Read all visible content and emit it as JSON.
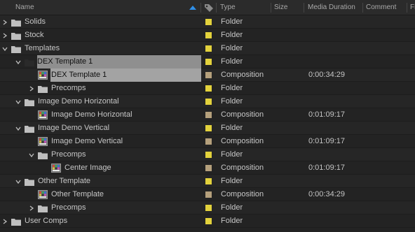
{
  "header": {
    "name": "Name",
    "type": "Type",
    "size": "Size",
    "media_duration": "Media Duration",
    "comment": "Comment",
    "fi": "Fi",
    "sort_direction": "ascending",
    "label_icon": "tag-icon",
    "sort_color": "#2f8fe8"
  },
  "colors": {
    "folder_label": "#e3d23c",
    "composition_label": "#b5a07c",
    "selection": "#a3a3a3"
  },
  "rows": [
    {
      "name": "Solids",
      "type": "Folder",
      "duration": "",
      "kind": "folder",
      "depth": 0,
      "expanded": false,
      "selected": false
    },
    {
      "name": "Stock",
      "type": "Folder",
      "duration": "",
      "kind": "folder",
      "depth": 0,
      "expanded": false,
      "selected": false
    },
    {
      "name": "Templates",
      "type": "Folder",
      "duration": "",
      "kind": "folder",
      "depth": 0,
      "expanded": true,
      "selected": false
    },
    {
      "name": "DEX Template 1",
      "type": "Folder",
      "duration": "",
      "kind": "folder",
      "depth": 1,
      "expanded": true,
      "selected": true
    },
    {
      "name": "DEX Template 1",
      "type": "Composition",
      "duration": "0:00:34:29",
      "kind": "comp",
      "depth": 2,
      "selected": true
    },
    {
      "name": "Precomps",
      "type": "Folder",
      "duration": "",
      "kind": "folder",
      "depth": 2,
      "expanded": false,
      "selected": false
    },
    {
      "name": "Image Demo Horizontal",
      "type": "Folder",
      "duration": "",
      "kind": "folder",
      "depth": 1,
      "expanded": true,
      "selected": false
    },
    {
      "name": "Image Demo Horizontal",
      "type": "Composition",
      "duration": "0:01:09:17",
      "kind": "comp",
      "depth": 2,
      "selected": false
    },
    {
      "name": "Image Demo Vertical",
      "type": "Folder",
      "duration": "",
      "kind": "folder",
      "depth": 1,
      "expanded": true,
      "selected": false
    },
    {
      "name": "Image Demo Vertical",
      "type": "Composition",
      "duration": "0:01:09:17",
      "kind": "comp",
      "depth": 2,
      "selected": false
    },
    {
      "name": "Precomps",
      "type": "Folder",
      "duration": "",
      "kind": "folder",
      "depth": 2,
      "expanded": true,
      "selected": false
    },
    {
      "name": "Center Image",
      "type": "Composition",
      "duration": "0:01:09:17",
      "kind": "comp",
      "depth": 3,
      "selected": false
    },
    {
      "name": "Other Template",
      "type": "Folder",
      "duration": "",
      "kind": "folder",
      "depth": 1,
      "expanded": true,
      "selected": false
    },
    {
      "name": "Other Template",
      "type": "Composition",
      "duration": "0:00:34:29",
      "kind": "comp",
      "depth": 2,
      "selected": false
    },
    {
      "name": "Precomps",
      "type": "Folder",
      "duration": "",
      "kind": "folder",
      "depth": 2,
      "expanded": false,
      "selected": false
    },
    {
      "name": "User Comps",
      "type": "Folder",
      "duration": "",
      "kind": "folder",
      "depth": 0,
      "expanded": false,
      "selected": false
    }
  ]
}
